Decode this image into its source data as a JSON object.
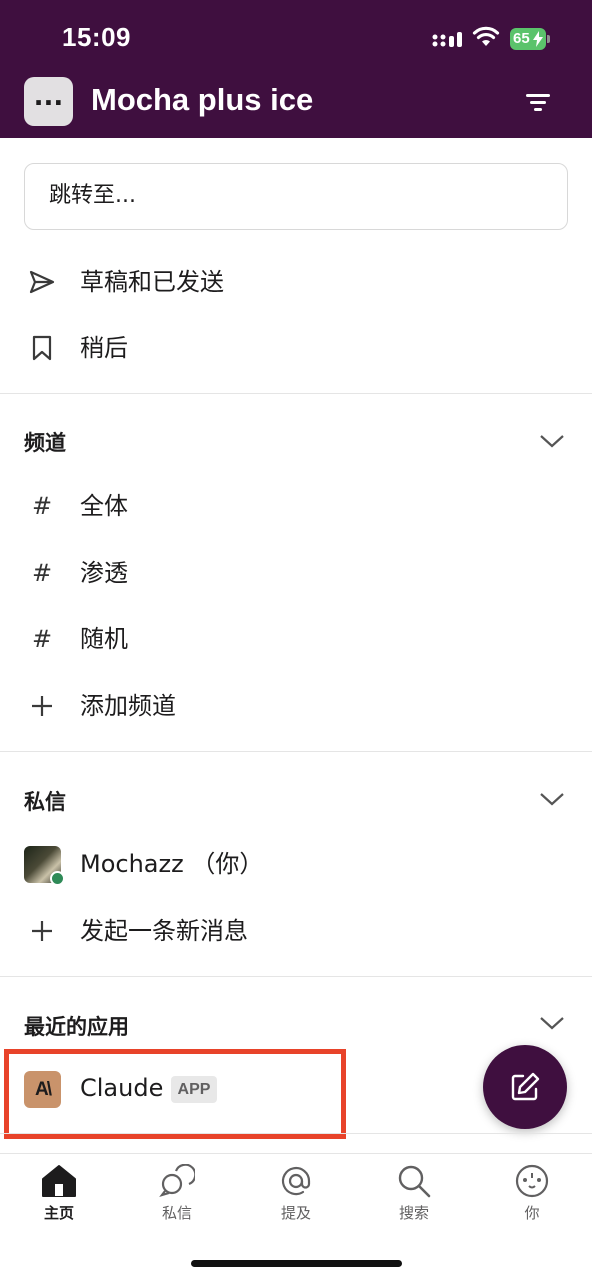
{
  "status_bar": {
    "time": "15:09",
    "battery": "65"
  },
  "header": {
    "workspace_icon": "...",
    "title": "Mocha plus ice",
    "filter_icon": "filter-icon"
  },
  "search": {
    "placeholder": "跳转至..."
  },
  "shortcuts": [
    {
      "label": "草稿和已发送",
      "icon": "send-icon"
    },
    {
      "label": "稍后",
      "icon": "bookmark-icon"
    }
  ],
  "channels": {
    "title": "频道",
    "items": [
      {
        "label": "全体",
        "icon": "hash-icon"
      },
      {
        "label": "渗透",
        "icon": "hash-icon"
      },
      {
        "label": "随机",
        "icon": "hash-icon"
      }
    ],
    "add_label": "添加频道",
    "hash": "#"
  },
  "direct_messages": {
    "title": "私信",
    "items": [
      {
        "label": "Mochazz （你）",
        "status": "online"
      }
    ],
    "new_label": "发起一条新消息"
  },
  "recent_apps": {
    "title": "最近的应用",
    "items": [
      {
        "label": "Claude",
        "badge": "APP",
        "logo_text": "A\\"
      }
    ]
  },
  "tabbar": {
    "tabs": [
      {
        "label": "主页",
        "icon": "home-icon",
        "active": true
      },
      {
        "label": "私信",
        "icon": "messages-icon",
        "active": false
      },
      {
        "label": "提及",
        "icon": "at-icon",
        "active": false
      },
      {
        "label": "搜索",
        "icon": "search-icon",
        "active": false
      },
      {
        "label": "你",
        "icon": "profile-icon",
        "active": false
      }
    ]
  },
  "colors": {
    "header_bg": "#3f0f3f",
    "fab_bg": "#3f0f3f",
    "highlight": "#e8432a",
    "presence": "#2e8a57",
    "battery": "#5bc36b"
  }
}
